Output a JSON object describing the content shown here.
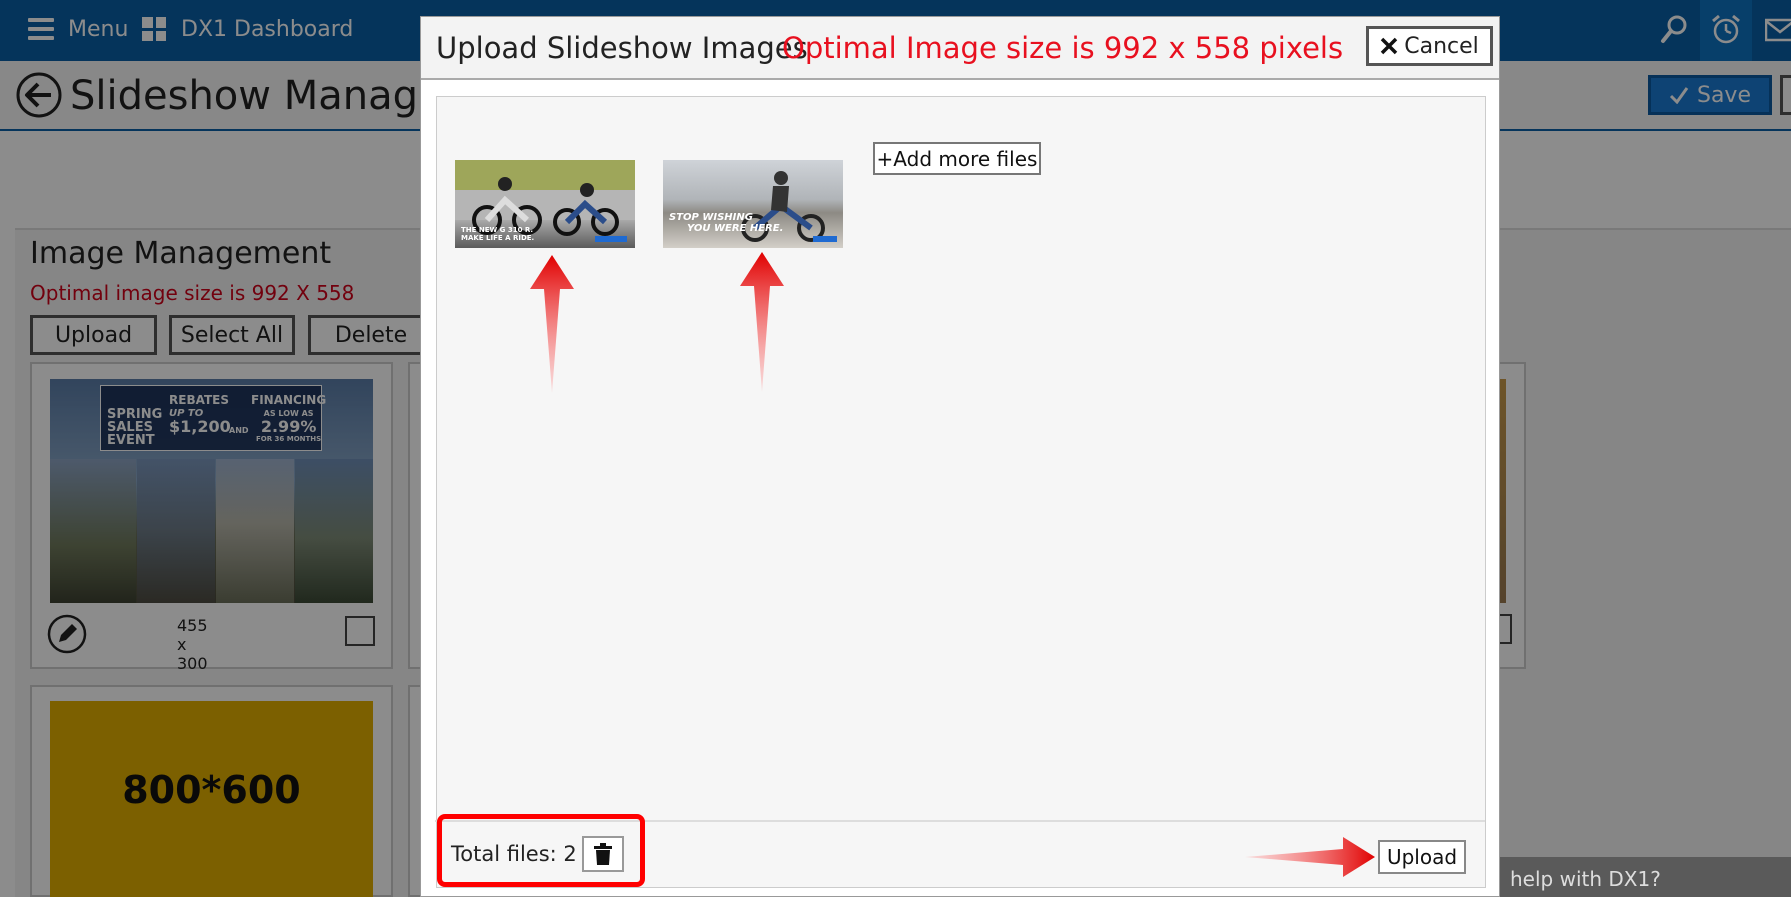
{
  "topbar": {
    "menu_label": "Menu",
    "dashboard_label": "DX1 Dashboard",
    "bg_color": "#0a5fa6"
  },
  "page_header": {
    "title": "Slideshow Management",
    "save_label": "Save"
  },
  "image_management": {
    "title": "Image Management",
    "subtitle": "Optimal image size is 992 X 558",
    "buttons": {
      "upload": "Upload",
      "select_all": "Select All",
      "delete": "Delete"
    },
    "cards": [
      {
        "dims": "455 x 300",
        "banner_lines": [
          "SPRING",
          "SALES",
          "EVENT"
        ],
        "rebates": "REBATES",
        "up_to": "UP TO",
        "amount": "$1,200",
        "and": "AND",
        "financing": "FINANCING",
        "as_low_as": "AS LOW AS",
        "rate": "2.99%",
        "months": "FOR 36 MONTHS"
      },
      {
        "label": "800*600"
      }
    ]
  },
  "help_tab": {
    "text": "help with DX1?"
  },
  "modal": {
    "title": "Upload Slideshow Images",
    "title_note": "Optimal Image size is 992 x 558 pixels",
    "cancel_label": "Cancel",
    "add_files_label": "+Add more files",
    "files": [
      {
        "caption_line1": "THE NEW G 310 R.",
        "caption_line2": "MAKE LIFE A RIDE."
      },
      {
        "caption_line1": "STOP WISHING",
        "caption_line2": "YOU WERE HERE."
      }
    ],
    "total_files_label": "Total files: 2",
    "upload_label": "Upload",
    "accent_red": "#e8101f"
  },
  "icons": {
    "menu": "hamburger-menu-icon",
    "dashboard": "dashboard-grid-icon",
    "search": "search-icon",
    "alarm": "alarm-clock-icon",
    "mail": "mail-icon",
    "back": "back-arrow-icon",
    "save": "check-icon",
    "cancel": "close-icon",
    "edit": "pencil-icon",
    "trash": "trash-icon"
  }
}
